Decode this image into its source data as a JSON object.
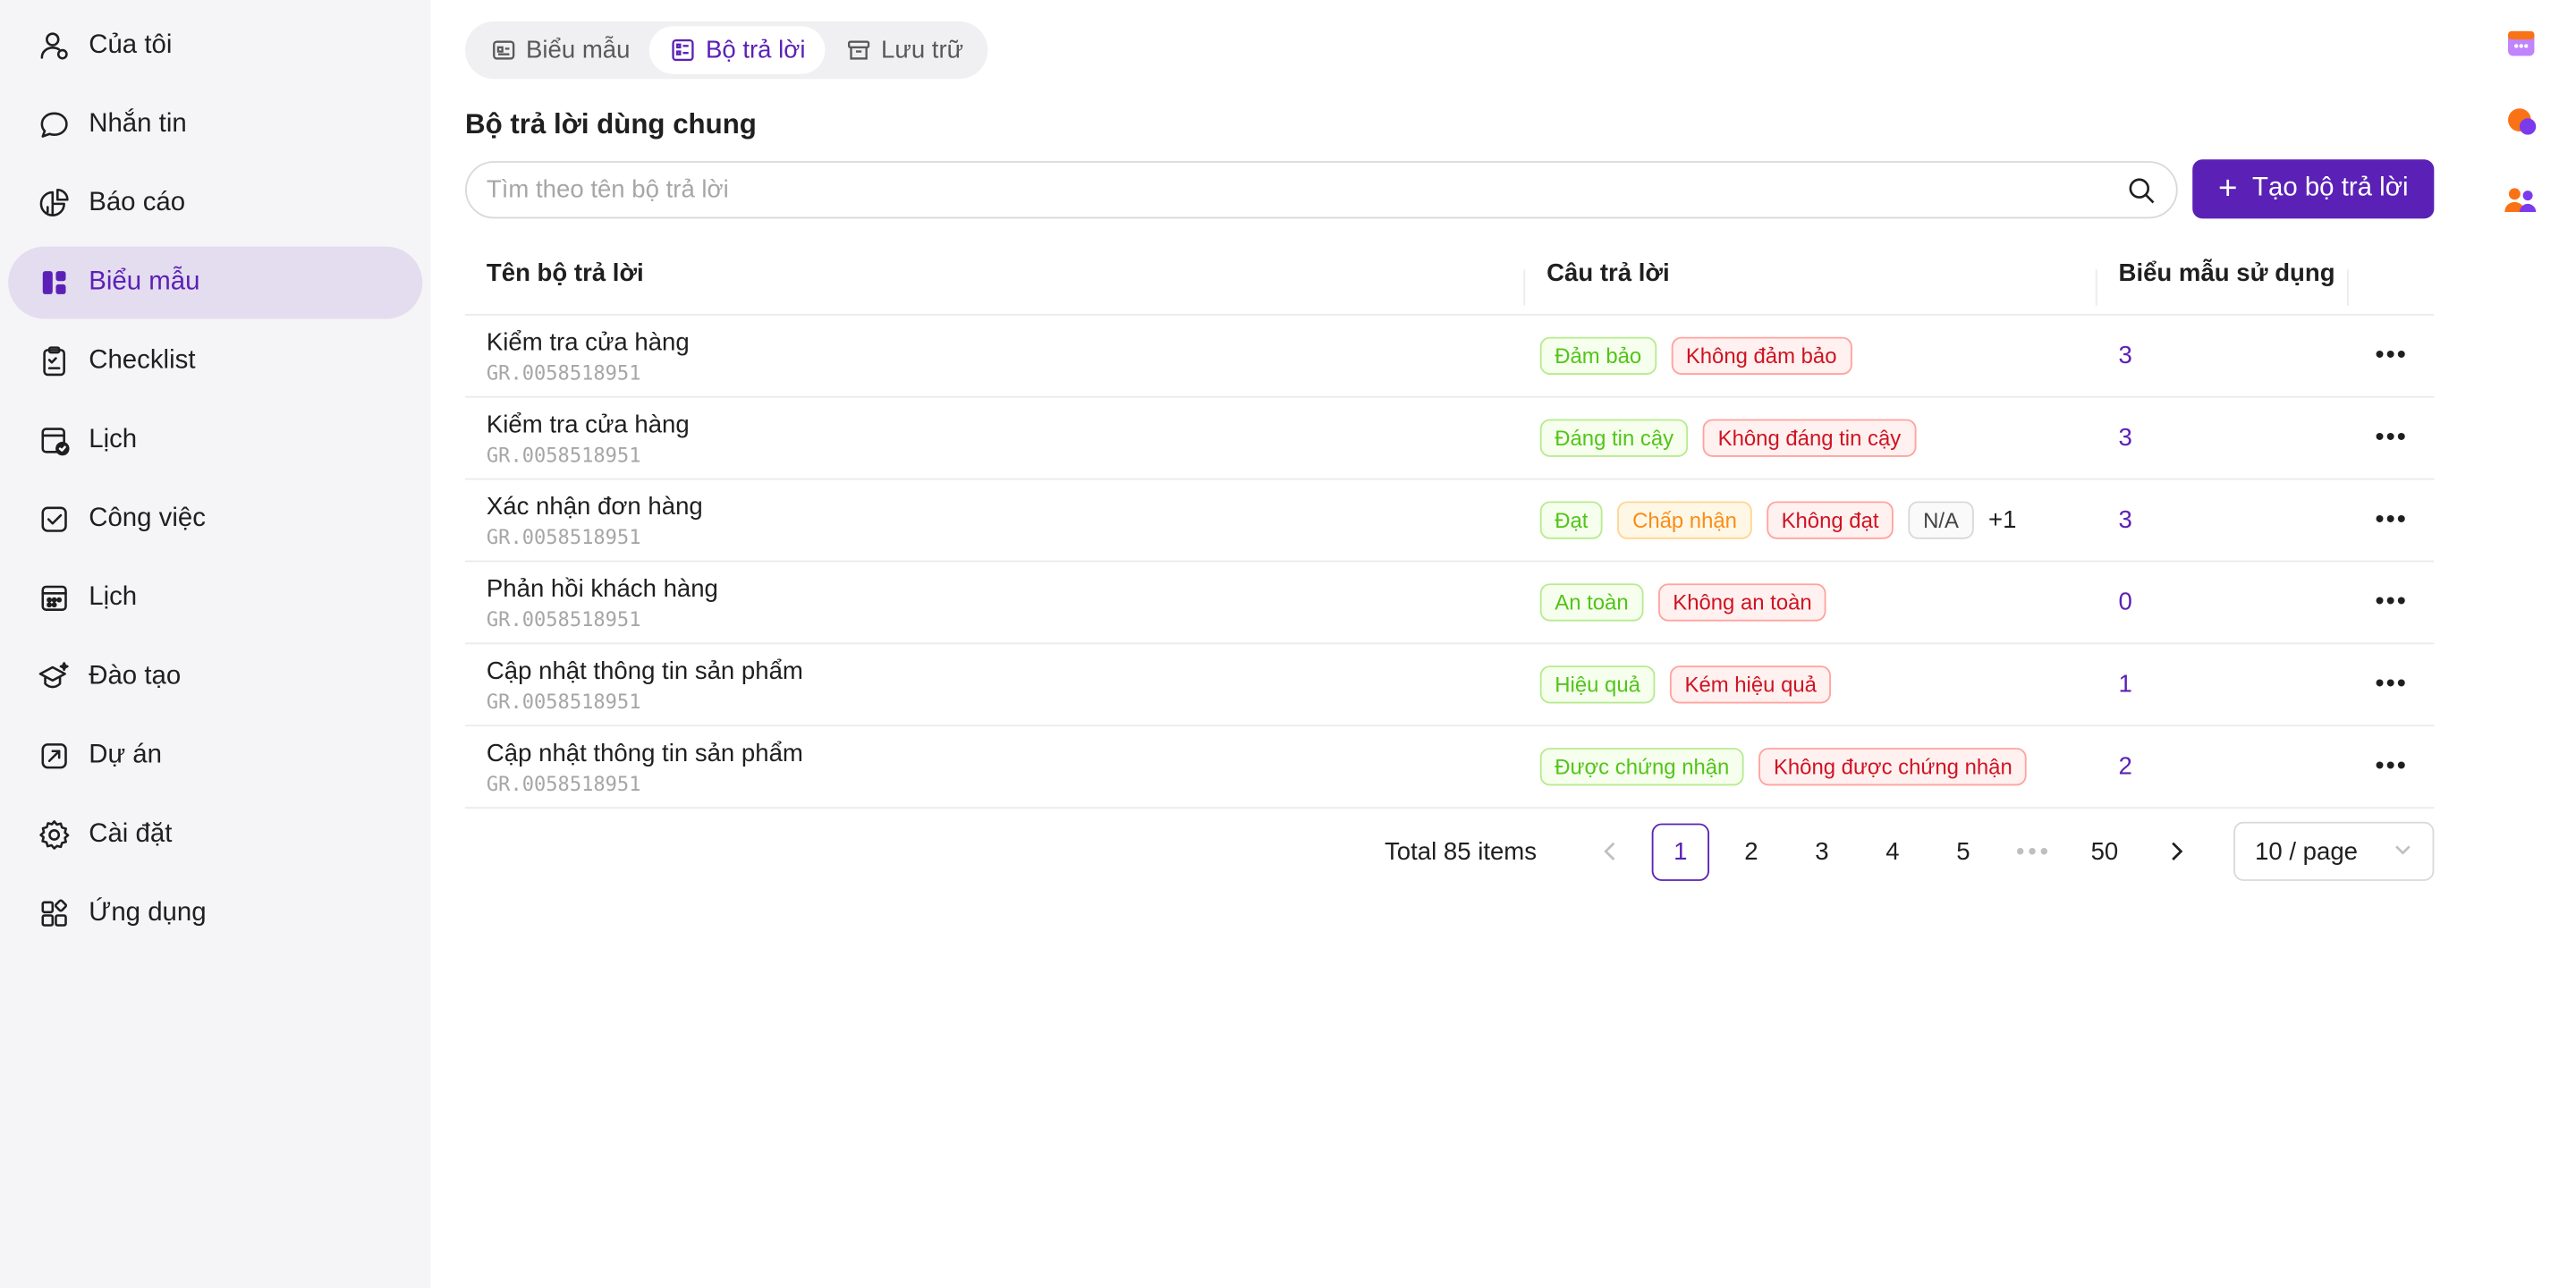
{
  "sidebar": {
    "items": [
      {
        "label": "Của tôi",
        "icon": "user-icon"
      },
      {
        "label": "Nhắn tin",
        "icon": "chat-icon"
      },
      {
        "label": "Báo cáo",
        "icon": "report-icon"
      },
      {
        "label": "Biểu mẫu",
        "icon": "form-icon",
        "active": true
      },
      {
        "label": "Checklist",
        "icon": "checklist-icon"
      },
      {
        "label": "Lịch",
        "icon": "calendar-check-icon"
      },
      {
        "label": "Công việc",
        "icon": "task-icon"
      },
      {
        "label": "Lịch",
        "icon": "calendar-icon"
      },
      {
        "label": "Đào tạo",
        "icon": "training-icon"
      },
      {
        "label": "Dự án",
        "icon": "project-icon"
      },
      {
        "label": "Cài đặt",
        "icon": "gear-icon"
      },
      {
        "label": "Ứng dụng",
        "icon": "apps-icon"
      }
    ]
  },
  "tabs": [
    {
      "label": "Biểu mẫu"
    },
    {
      "label": "Bộ trả lời",
      "active": true
    },
    {
      "label": "Lưu trữ"
    }
  ],
  "section_title": "Bộ trả lời dùng chung",
  "search": {
    "placeholder": "Tìm theo tên bộ trả lời",
    "value": ""
  },
  "create_button": "Tạo bộ trả lời",
  "table": {
    "headers": {
      "name": "Tên bộ trả lời",
      "answers": "Câu trả lời",
      "usage": "Biểu mẫu sử dụng"
    },
    "rows": [
      {
        "name": "Kiểm tra cửa hàng",
        "code": "GR.0058518951",
        "usage": "3",
        "tags": [
          {
            "text": "Đảm bảo",
            "color": "green"
          },
          {
            "text": "Không đảm bảo",
            "color": "red"
          }
        ],
        "more": ""
      },
      {
        "name": "Kiểm tra cửa hàng",
        "code": "GR.0058518951",
        "usage": "3",
        "tags": [
          {
            "text": "Đáng tin cậy",
            "color": "green"
          },
          {
            "text": "Không đáng tin cậy",
            "color": "red"
          }
        ],
        "more": ""
      },
      {
        "name": "Xác nhận đơn hàng",
        "code": "GR.0058518951",
        "usage": "3",
        "tags": [
          {
            "text": "Đạt",
            "color": "green"
          },
          {
            "text": "Chấp nhận",
            "color": "orange"
          },
          {
            "text": "Không đạt",
            "color": "red"
          },
          {
            "text": "N/A",
            "color": "gray"
          }
        ],
        "more": "+1"
      },
      {
        "name": "Phản hồi khách hàng",
        "code": "GR.0058518951",
        "usage": "0",
        "tags": [
          {
            "text": "An toàn",
            "color": "green"
          },
          {
            "text": "Không an toàn",
            "color": "red"
          }
        ],
        "more": ""
      },
      {
        "name": "Cập nhật thông tin sản phẩm",
        "code": "GR.0058518951",
        "usage": "1",
        "tags": [
          {
            "text": "Hiệu quả",
            "color": "green"
          },
          {
            "text": "Kém hiệu quả",
            "color": "red"
          }
        ],
        "more": ""
      },
      {
        "name": "Cập nhật thông tin sản phẩm",
        "code": "GR.0058518951",
        "usage": "2",
        "tags": [
          {
            "text": "Được chứng nhận",
            "color": "green"
          },
          {
            "text": "Không được chứng nhận",
            "color": "red"
          }
        ],
        "more": ""
      }
    ]
  },
  "pagination": {
    "total": "Total 85 items",
    "pages": [
      "1",
      "2",
      "3",
      "4",
      "5",
      "•••",
      "50"
    ],
    "current": "1",
    "page_size": "10 / page"
  },
  "colors": {
    "accent": "#5b21b6",
    "active_bg": "#e4dcef"
  }
}
